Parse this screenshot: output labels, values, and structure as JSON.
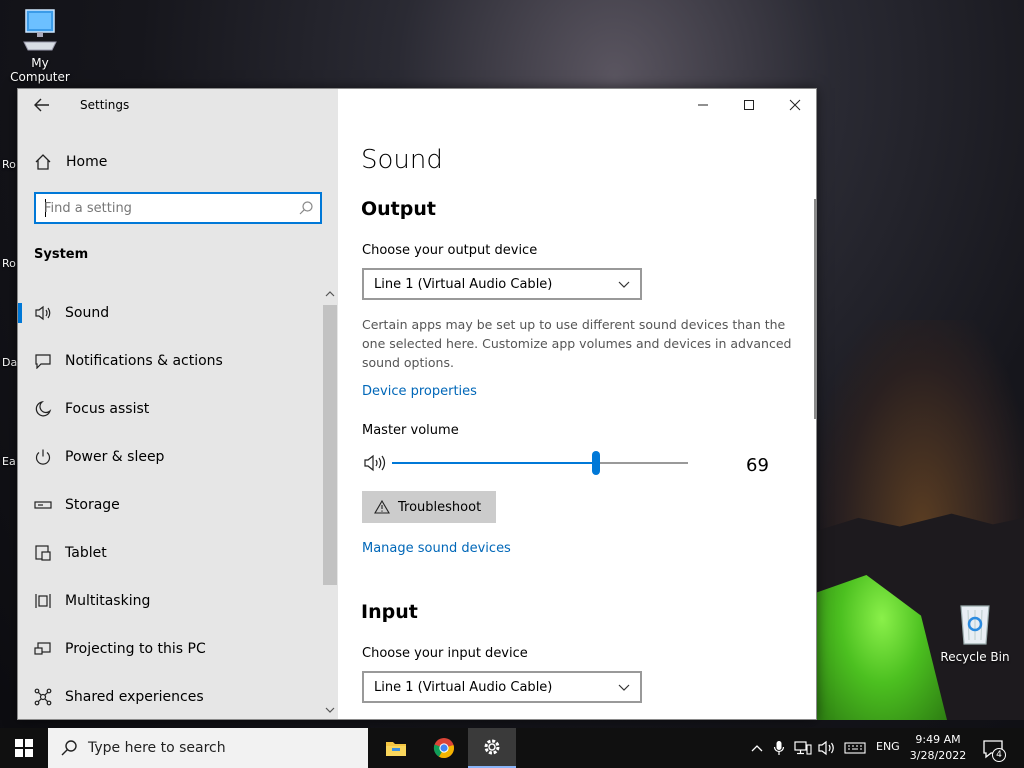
{
  "desktop": {
    "icons": [
      {
        "label": "My Computer",
        "icon": "computer-icon"
      },
      {
        "label": "Recycle Bin",
        "icon": "recycle-bin-icon"
      }
    ],
    "edge_labels": [
      "Ro",
      "Ro",
      "Da",
      "Ea"
    ]
  },
  "window": {
    "app_title": "Settings",
    "controls": {
      "minimize": "minimize-icon",
      "maximize": "maximize-icon",
      "close": "close-icon"
    }
  },
  "sidebar": {
    "home_label": "Home",
    "search_placeholder": "Find a setting",
    "group_label": "System",
    "items": [
      {
        "label": "Sound",
        "icon": "speaker-icon",
        "active": true
      },
      {
        "label": "Notifications & actions",
        "icon": "notification-icon"
      },
      {
        "label": "Focus assist",
        "icon": "moon-icon"
      },
      {
        "label": "Power & sleep",
        "icon": "power-icon"
      },
      {
        "label": "Storage",
        "icon": "storage-icon"
      },
      {
        "label": "Tablet",
        "icon": "tablet-icon"
      },
      {
        "label": "Multitasking",
        "icon": "multitasking-icon"
      },
      {
        "label": "Projecting to this PC",
        "icon": "projecting-icon"
      },
      {
        "label": "Shared experiences",
        "icon": "shared-icon"
      }
    ]
  },
  "content": {
    "title": "Sound",
    "output": {
      "heading": "Output",
      "device_label": "Choose your output device",
      "device_value": "Line 1 (Virtual Audio Cable)",
      "description": "Certain apps may be set up to use different sound devices than the one selected here. Customize app volumes and devices in advanced sound options.",
      "device_properties_link": "Device properties",
      "master_volume_label": "Master volume",
      "master_volume_value": "69",
      "volume_fraction": 0.69,
      "troubleshoot_label": "Troubleshoot",
      "manage_link": "Manage sound devices"
    },
    "input": {
      "heading": "Input",
      "device_label": "Choose your input device",
      "device_value": "Line 1 (Virtual Audio Cable)"
    }
  },
  "taskbar": {
    "search_placeholder": "Type here to search",
    "apps": [
      "file-explorer-icon",
      "chrome-icon",
      "settings-icon"
    ],
    "language": "ENG",
    "time": "9:49 AM",
    "date": "3/28/2022",
    "notification_count": "4"
  },
  "colors": {
    "accent": "#0078d7",
    "link": "#0067b8",
    "sidebar_bg": "#e6e6e6"
  }
}
